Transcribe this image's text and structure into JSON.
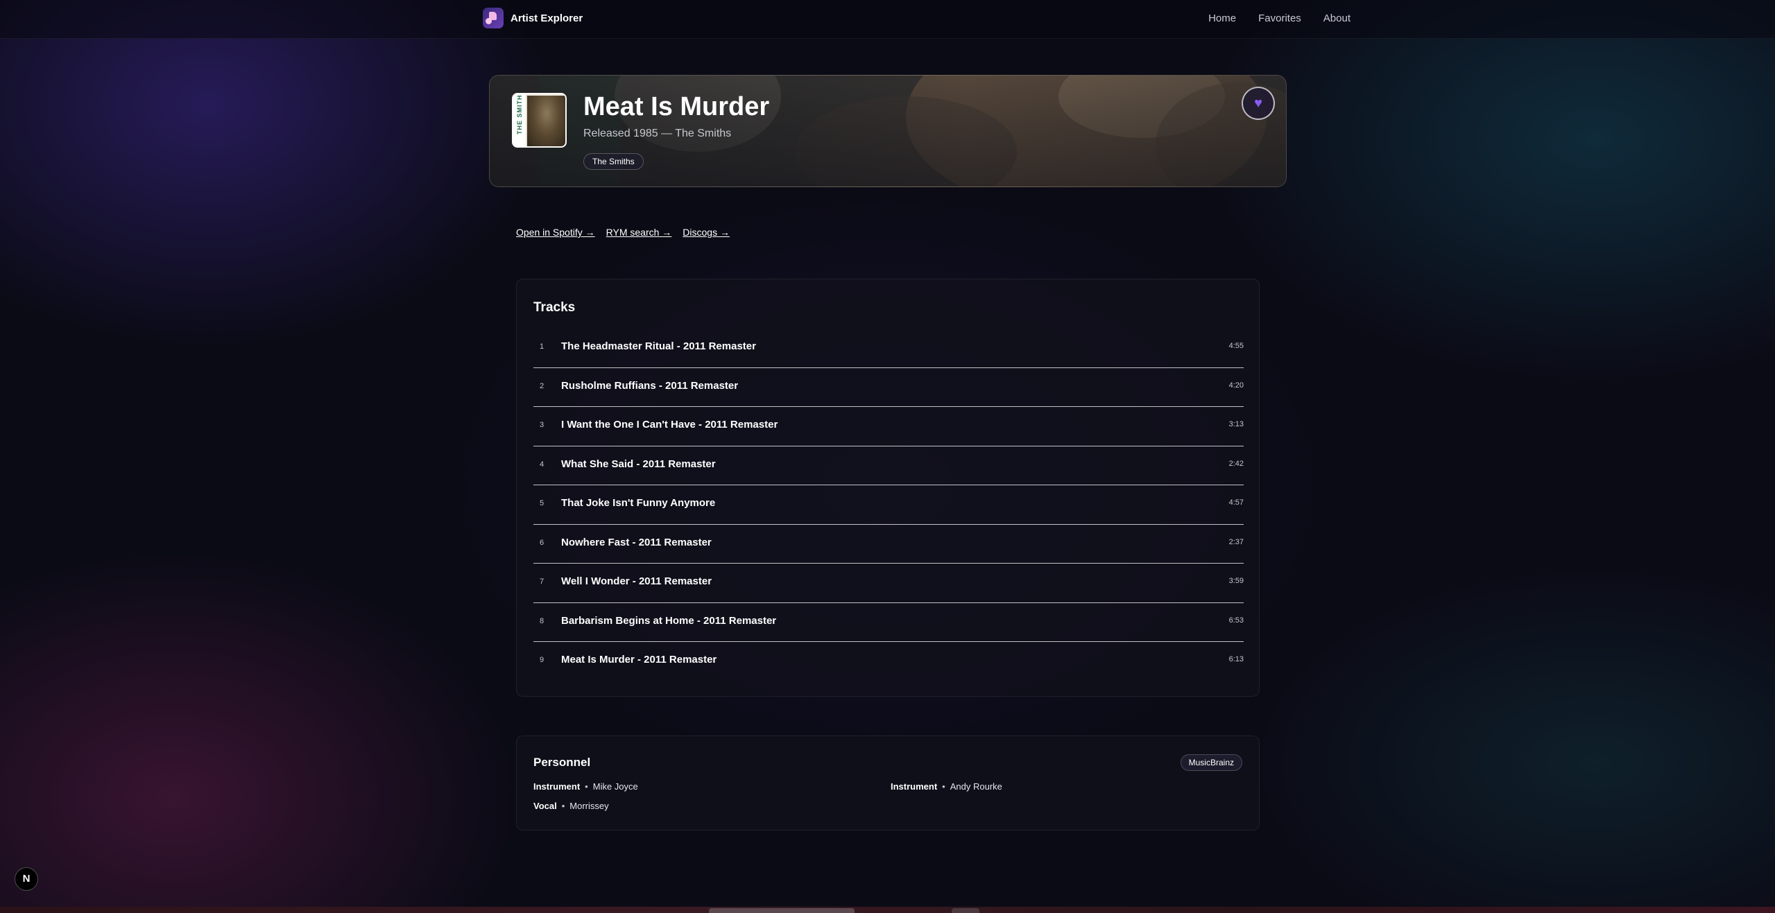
{
  "app": {
    "name": "Artist Explorer",
    "nav": [
      "Home",
      "Favorites",
      "About"
    ]
  },
  "album": {
    "title": "Meat Is Murder",
    "subtitle": "Released 1985 — The Smiths",
    "artist_tag": "The Smiths",
    "cover_text": "THE SMITHS",
    "favorite_icon": "heart-icon"
  },
  "links": [
    "Open in Spotify →",
    "RYM search →",
    "Discogs →"
  ],
  "tracks": {
    "heading": "Tracks",
    "items": [
      {
        "num": "1",
        "title": "The Headmaster Ritual - 2011 Remaster",
        "duration": "4:55"
      },
      {
        "num": "2",
        "title": "Rusholme Ruffians - 2011 Remaster",
        "duration": "4:20"
      },
      {
        "num": "3",
        "title": "I Want the One I Can't Have - 2011 Remaster",
        "duration": "3:13"
      },
      {
        "num": "4",
        "title": "What She Said - 2011 Remaster",
        "duration": "2:42"
      },
      {
        "num": "5",
        "title": "That Joke Isn't Funny Anymore",
        "duration": "4:57"
      },
      {
        "num": "6",
        "title": "Nowhere Fast - 2011 Remaster",
        "duration": "2:37"
      },
      {
        "num": "7",
        "title": "Well I Wonder - 2011 Remaster",
        "duration": "3:59"
      },
      {
        "num": "8",
        "title": "Barbarism Begins at Home - 2011 Remaster",
        "duration": "6:53"
      },
      {
        "num": "9",
        "title": "Meat Is Murder - 2011 Remaster",
        "duration": "6:13"
      }
    ]
  },
  "personnel": {
    "heading": "Personnel",
    "source_badge": "MusicBrainz",
    "separator": "•",
    "entries": [
      {
        "role": "Instrument",
        "name": "Mike Joyce"
      },
      {
        "role": "Instrument",
        "name": "Andy Rourke"
      },
      {
        "role": "Vocal",
        "name": "Morrissey"
      }
    ]
  },
  "dev_badge": "N",
  "colors": {
    "accent": "#8b5cf6",
    "background": "#0b0b16",
    "card": "#11111b"
  }
}
